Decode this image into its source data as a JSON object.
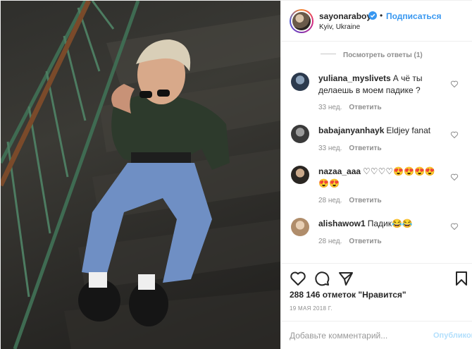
{
  "header": {
    "username": "sayonaraboy",
    "follow_label": "Подписаться",
    "dot": "•",
    "location": "Kyiv, Ukraine",
    "verified_icon": "verified-badge-icon",
    "verified_color": "#3897f0"
  },
  "comments": {
    "view_replies": "Посмотреть ответы (1)",
    "items": [
      {
        "user": "yuliana_myslivets",
        "text": "А чё ты делаешь в моем падике ?",
        "time": "33 нед.",
        "reply": "Ответить"
      },
      {
        "user": "babajanyanhayk",
        "text": "Eldjey fanat",
        "time": "33 нед.",
        "reply": "Ответить"
      },
      {
        "user": "nazaa_aaa",
        "text": "♡♡♡♡😍😍😍😍😍😍",
        "time": "28 нед.",
        "reply": "Ответить"
      },
      {
        "user": "alishawow1",
        "text": "Падик😂😂",
        "time": "28 нед.",
        "reply": "Ответить"
      }
    ]
  },
  "actions": {
    "like_icon": "heart-icon",
    "comment_icon": "comment-icon",
    "share_icon": "share-icon",
    "save_icon": "bookmark-icon"
  },
  "likes": "288 146 отметок \"Нравится\"",
  "date": "19 МАЯ 2018 Г.",
  "add_comment": {
    "placeholder": "Добавьте комментарий...",
    "publish_label": "Опубликовать",
    "publish_color": "#b2dffc"
  }
}
